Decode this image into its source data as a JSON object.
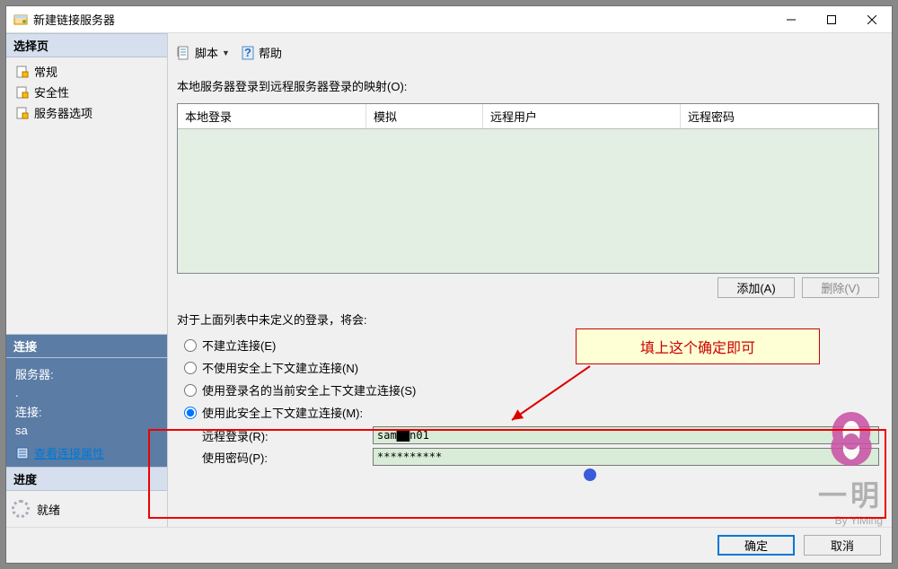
{
  "window": {
    "title": "新建链接服务器"
  },
  "sidebar": {
    "selectPageHeader": "选择页",
    "pages": [
      {
        "label": "常规"
      },
      {
        "label": "安全性"
      },
      {
        "label": "服务器选项"
      }
    ],
    "connectionHeader": "连接",
    "serverLabel": "服务器:",
    "serverValue": ".",
    "connLabel": "连接:",
    "connValue": "sa",
    "viewPropsLink": "查看连接属性",
    "progressHeader": "进度",
    "progressStatus": "就绪"
  },
  "toolbar": {
    "script": "脚本",
    "help": "帮助"
  },
  "main": {
    "mappingLabel": "本地服务器登录到远程服务器登录的映射(O):",
    "gridHeaders": {
      "c1": "本地登录",
      "c2": "模拟",
      "c3": "远程用户",
      "c4": "远程密码"
    },
    "addBtn": "添加(A)",
    "removeBtn": "删除(V)",
    "undefLabel": "对于上面列表中未定义的登录，将会:",
    "radios": {
      "r1": "不建立连接(E)",
      "r2": "不使用安全上下文建立连接(N)",
      "r3": "使用登录名的当前安全上下文建立连接(S)",
      "r4": "使用此安全上下文建立连接(M):"
    },
    "remoteLoginLabel": "远程登录(R):",
    "remoteLoginValue": "sam██n01",
    "passwordLabel": "使用密码(P):",
    "passwordValue": "**********"
  },
  "callout": {
    "text": "填上这个确定即可"
  },
  "footer": {
    "ok": "确定",
    "cancel": "取消"
  },
  "watermark": {
    "text": "一明",
    "sub": "By YiMing"
  }
}
